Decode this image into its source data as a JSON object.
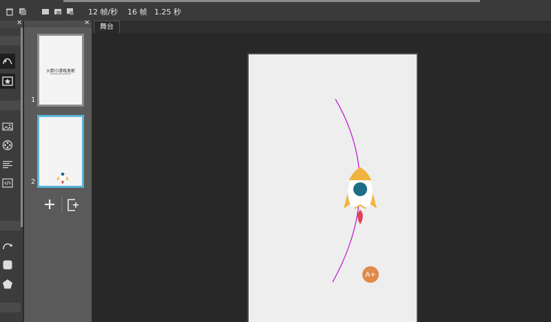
{
  "toolbar": {
    "fps_label": "12 帧/秒",
    "frames_label": "16 帧",
    "duration_label": "1.25 秒"
  },
  "slides_panel": {
    "slides": [
      {
        "number": "1",
        "thumbnail_title": "火箭小游戏发射"
      },
      {
        "number": "2"
      }
    ],
    "selected_slide": "2"
  },
  "stage": {
    "tab_label": "舞台",
    "add_text_badge": "A+"
  },
  "colors": {
    "accent_selection": "#58b4d8",
    "motion_path": "#c020d0",
    "rocket_body": "#ffffff",
    "rocket_fins": "#f0b440",
    "rocket_window": "#1d6e86",
    "rocket_flame": "#e0405a",
    "badge": "#e08a4a"
  }
}
